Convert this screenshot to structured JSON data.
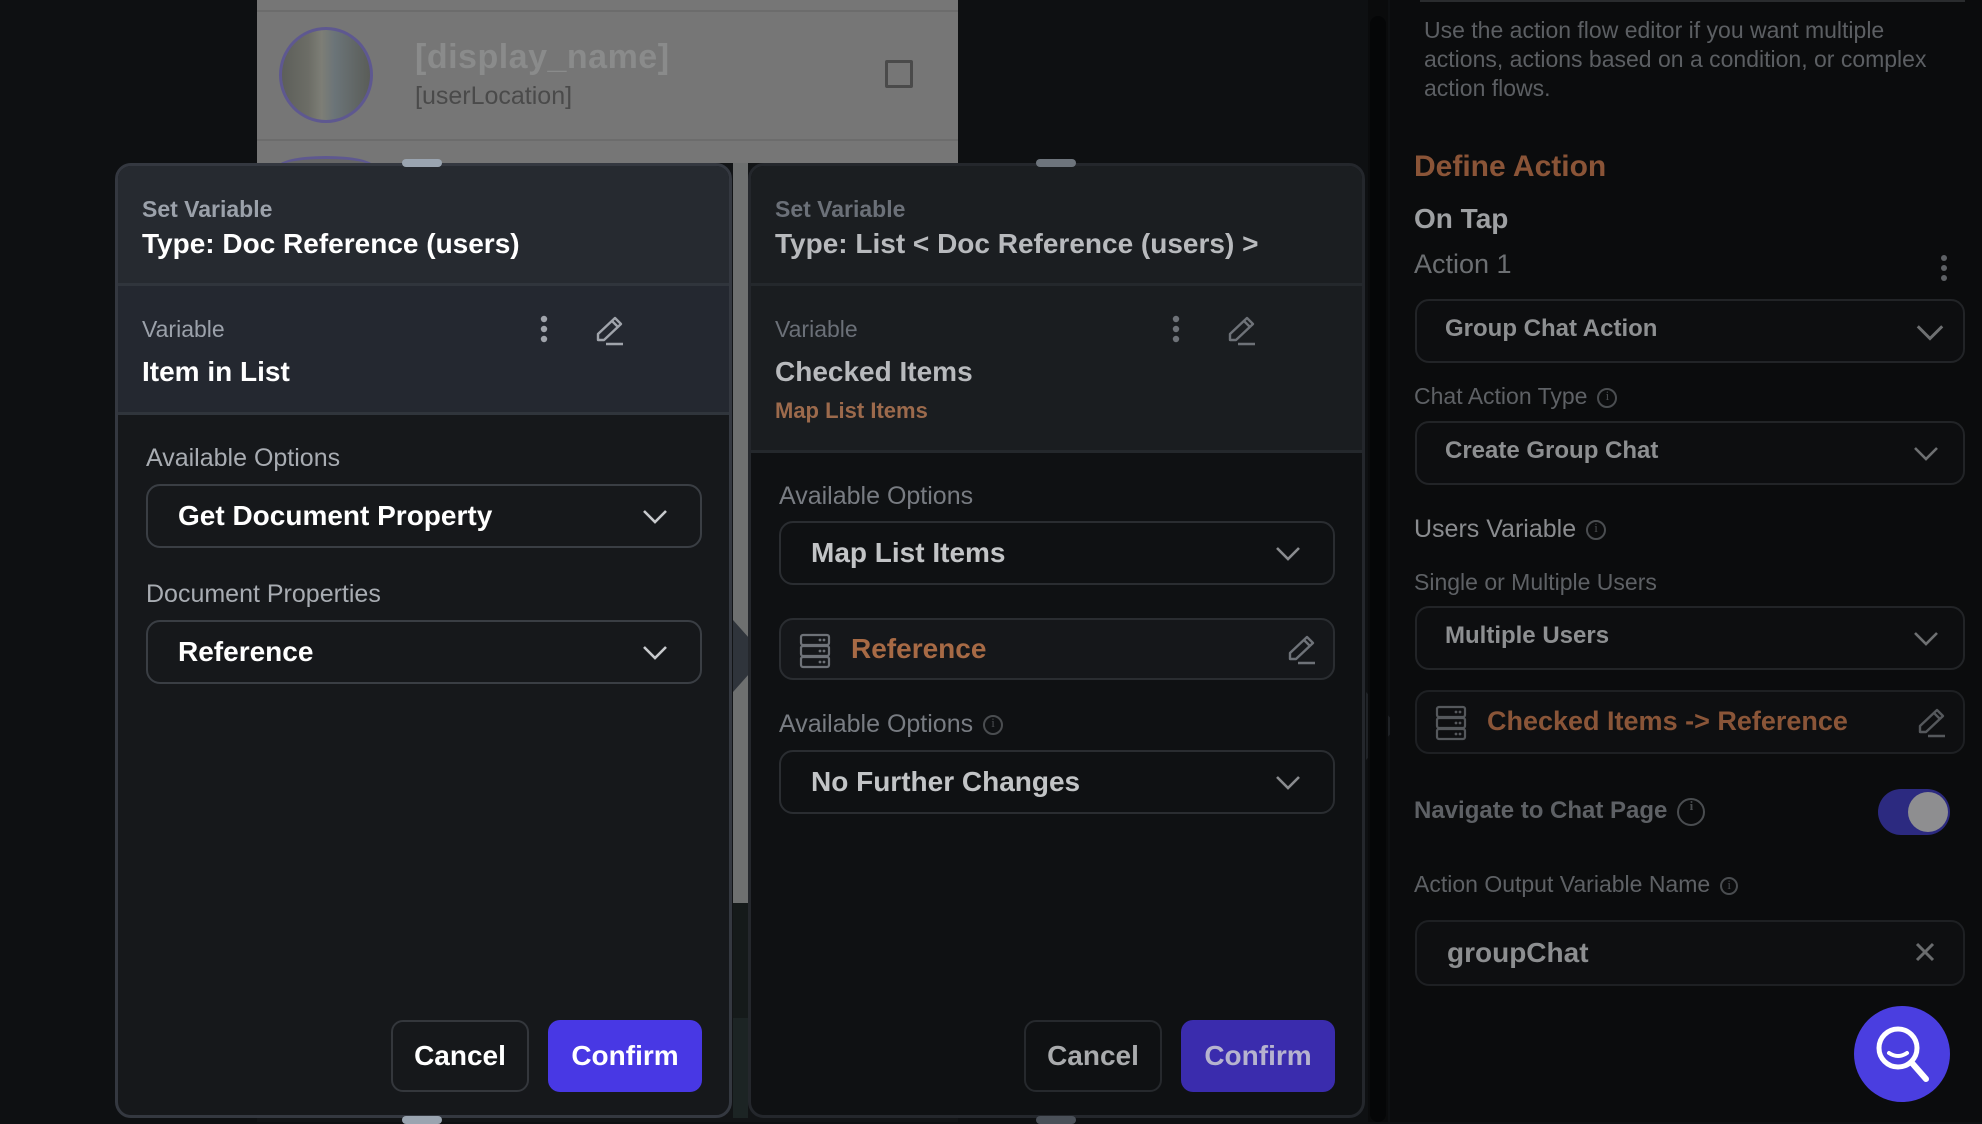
{
  "background_preview": {
    "list_item": {
      "display_name": "[display_name]",
      "user_location": "[userLocation]",
      "checkbox_checked": false
    }
  },
  "modal_item_in_list": {
    "kicker": "Set Variable",
    "type": "Type: Doc Reference (users)",
    "variable_label": "Variable",
    "variable_name": "Item in List",
    "available_options_label": "Available Options",
    "available_options_value": "Get Document Property",
    "document_properties_label": "Document Properties",
    "document_properties_value": "Reference",
    "cancel_label": "Cancel",
    "confirm_label": "Confirm"
  },
  "modal_checked_items": {
    "kicker": "Set Variable",
    "type": "Type: List < Doc Reference (users) >",
    "variable_label": "Variable",
    "variable_name": "Checked Items",
    "variable_sub": "Map List Items",
    "available_options_label": "Available Options",
    "available_options_value": "Map List Items",
    "mapped_field": "Reference",
    "available_options_2_label": "Available Options",
    "available_options_2_value": "No Further Changes",
    "cancel_label": "Cancel",
    "confirm_label": "Confirm"
  },
  "right_panel": {
    "description": "Use the action flow editor if you want multiple actions, actions based on a condition, or complex action flows.",
    "section_title": "Define Action",
    "trigger": "On Tap",
    "action_label": "Action 1",
    "action_type_value": "Group Chat Action",
    "chat_action_type_label": "Chat Action Type",
    "chat_action_type_value": "Create Group Chat",
    "users_variable_label": "Users Variable",
    "single_multiple_label": "Single or Multiple Users",
    "single_multiple_value": "Multiple Users",
    "users_variable_value": "Checked Items -> Reference",
    "navigate_label": "Navigate to Chat Page",
    "navigate_enabled": true,
    "output_var_label": "Action Output Variable Name",
    "output_var_value": "groupChat"
  },
  "colors": {
    "accent": "#4838e4",
    "orange": "#a76a45"
  }
}
